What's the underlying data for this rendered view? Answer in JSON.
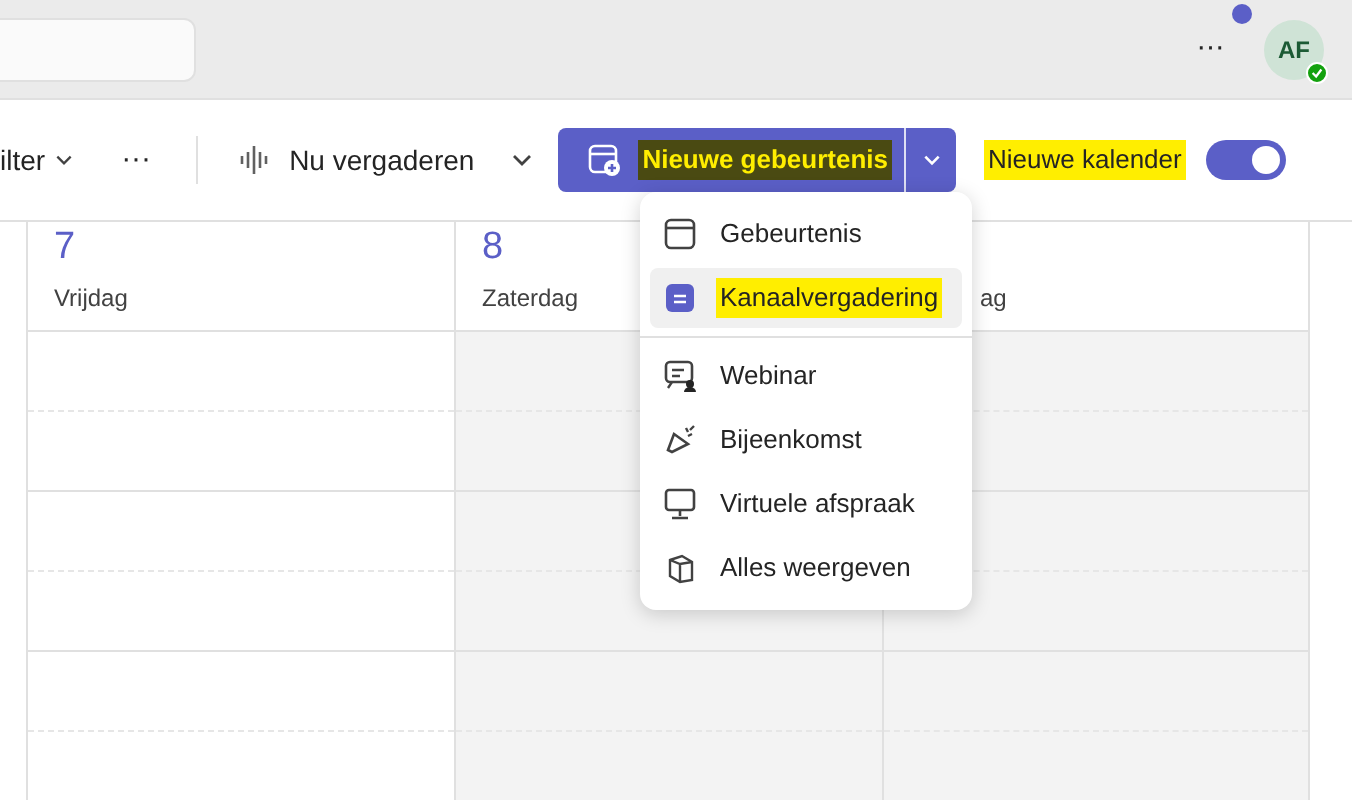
{
  "top_bar": {
    "more": "···",
    "avatar": {
      "initials": "AF",
      "status_available": true,
      "notification_dot": true
    }
  },
  "toolbar": {
    "filter": "ilter",
    "more": "···",
    "meet_now": "Nu vergaderen",
    "new_event": {
      "label": "Nieuwe gebeurtenis",
      "highlighted": true
    },
    "new_calendar": {
      "label": "Nieuwe kalender",
      "highlighted": true,
      "on": true
    }
  },
  "days": [
    {
      "number": "7",
      "weekday": "Vrijdag",
      "weekend": false
    },
    {
      "number": "8",
      "weekday": "Zaterdag",
      "weekend": true
    },
    {
      "weekday": "ag",
      "weekend": true
    }
  ],
  "menu": {
    "items": [
      {
        "label": "Gebeurtenis",
        "selected": false,
        "highlighted": false
      },
      {
        "label": "Kanaalvergadering",
        "selected": true,
        "highlighted": true
      },
      {
        "label": "Webinar",
        "selected": false,
        "highlighted": false,
        "divider_before": true
      },
      {
        "label": "Bijeenkomst",
        "selected": false,
        "highlighted": false
      },
      {
        "label": "Virtuele afspraak",
        "selected": false,
        "highlighted": false
      },
      {
        "label": "Alles weergeven",
        "selected": false,
        "highlighted": false
      }
    ]
  }
}
